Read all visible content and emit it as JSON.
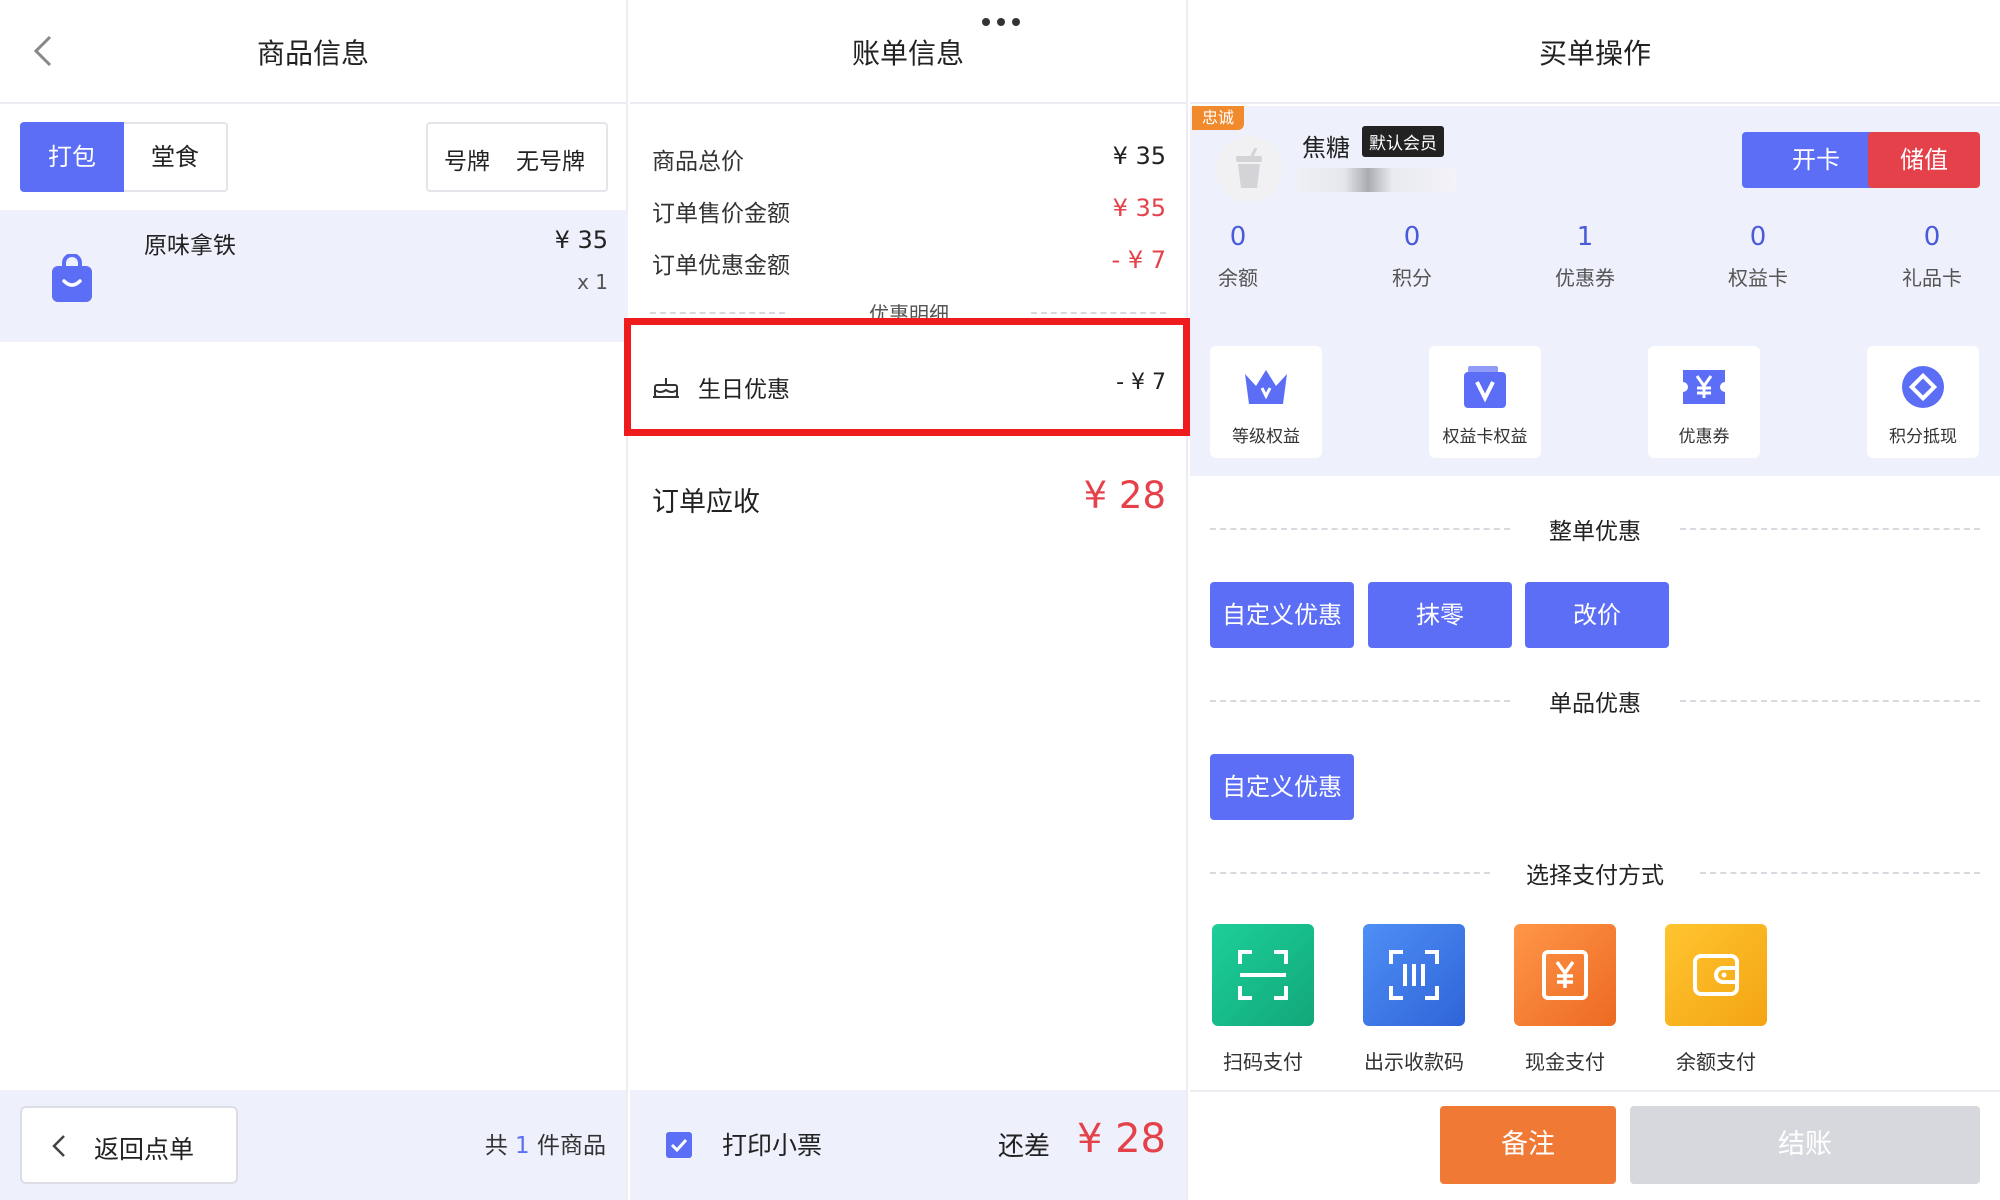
{
  "left": {
    "title": "商品信息",
    "tabs": [
      "打包",
      "堂食"
    ],
    "plate_label": "号牌",
    "plate_value": "无号牌",
    "item": {
      "name": "原味拿铁",
      "price": "¥ 35",
      "qty": "x 1"
    },
    "back_label": "返回点单",
    "count_prefix": "共",
    "count": "1",
    "count_suffix": "件商品"
  },
  "middle": {
    "title": "账单信息",
    "rows": [
      {
        "label": "商品总价",
        "value": "¥ 35"
      },
      {
        "label": "订单售价金额",
        "value": "¥ 35"
      },
      {
        "label": "订单优惠金额",
        "value": "- ¥ 7"
      }
    ],
    "detail_header": "优惠明细",
    "discount": {
      "label": "生日优惠",
      "value": "- ¥ 7"
    },
    "receivable_label": "订单应收",
    "receivable_value": "¥ 28",
    "print_label": "打印小票",
    "balance_label": "还差",
    "balance_value": "¥ 28"
  },
  "right": {
    "title": "买单操作",
    "member_tag": "忠诚",
    "member_name": "焦糖",
    "member_badge": "默认会员",
    "open_card": "开卡",
    "recharge": "储值",
    "stats": [
      {
        "value": "0",
        "label": "余额"
      },
      {
        "value": "0",
        "label": "积分"
      },
      {
        "value": "1",
        "label": "优惠券"
      },
      {
        "value": "0",
        "label": "权益卡"
      },
      {
        "value": "0",
        "label": "礼品卡"
      }
    ],
    "features": [
      {
        "label": "等级权益",
        "icon": "crown-icon"
      },
      {
        "label": "权益卡权益",
        "icon": "card-v-icon"
      },
      {
        "label": "优惠券",
        "icon": "coupon-icon"
      },
      {
        "label": "积分抵现",
        "icon": "diamond-icon"
      }
    ],
    "order_discount_title": "整单优惠",
    "order_discount_buttons": [
      "自定义优惠",
      "抹零",
      "改价"
    ],
    "item_discount_title": "单品优惠",
    "item_discount_button": "自定义优惠",
    "payment_title": "选择支付方式",
    "payments": [
      {
        "label": "扫码支付",
        "icon": "scan-icon",
        "color": "#17b98a"
      },
      {
        "label": "出示收款码",
        "icon": "barcode-icon",
        "color": "#3d7be8"
      },
      {
        "label": "现金支付",
        "icon": "cash-icon",
        "color": "#f07a35"
      },
      {
        "label": "余额支付",
        "icon": "wallet-icon",
        "color": "#f5b021"
      }
    ],
    "note_button": "备注",
    "checkout_button": "结账"
  },
  "colors": {
    "accent": "#5b6ef5",
    "red": "#e5414a",
    "orange": "#f07a35",
    "highlight_border": "#ee1c1c"
  }
}
